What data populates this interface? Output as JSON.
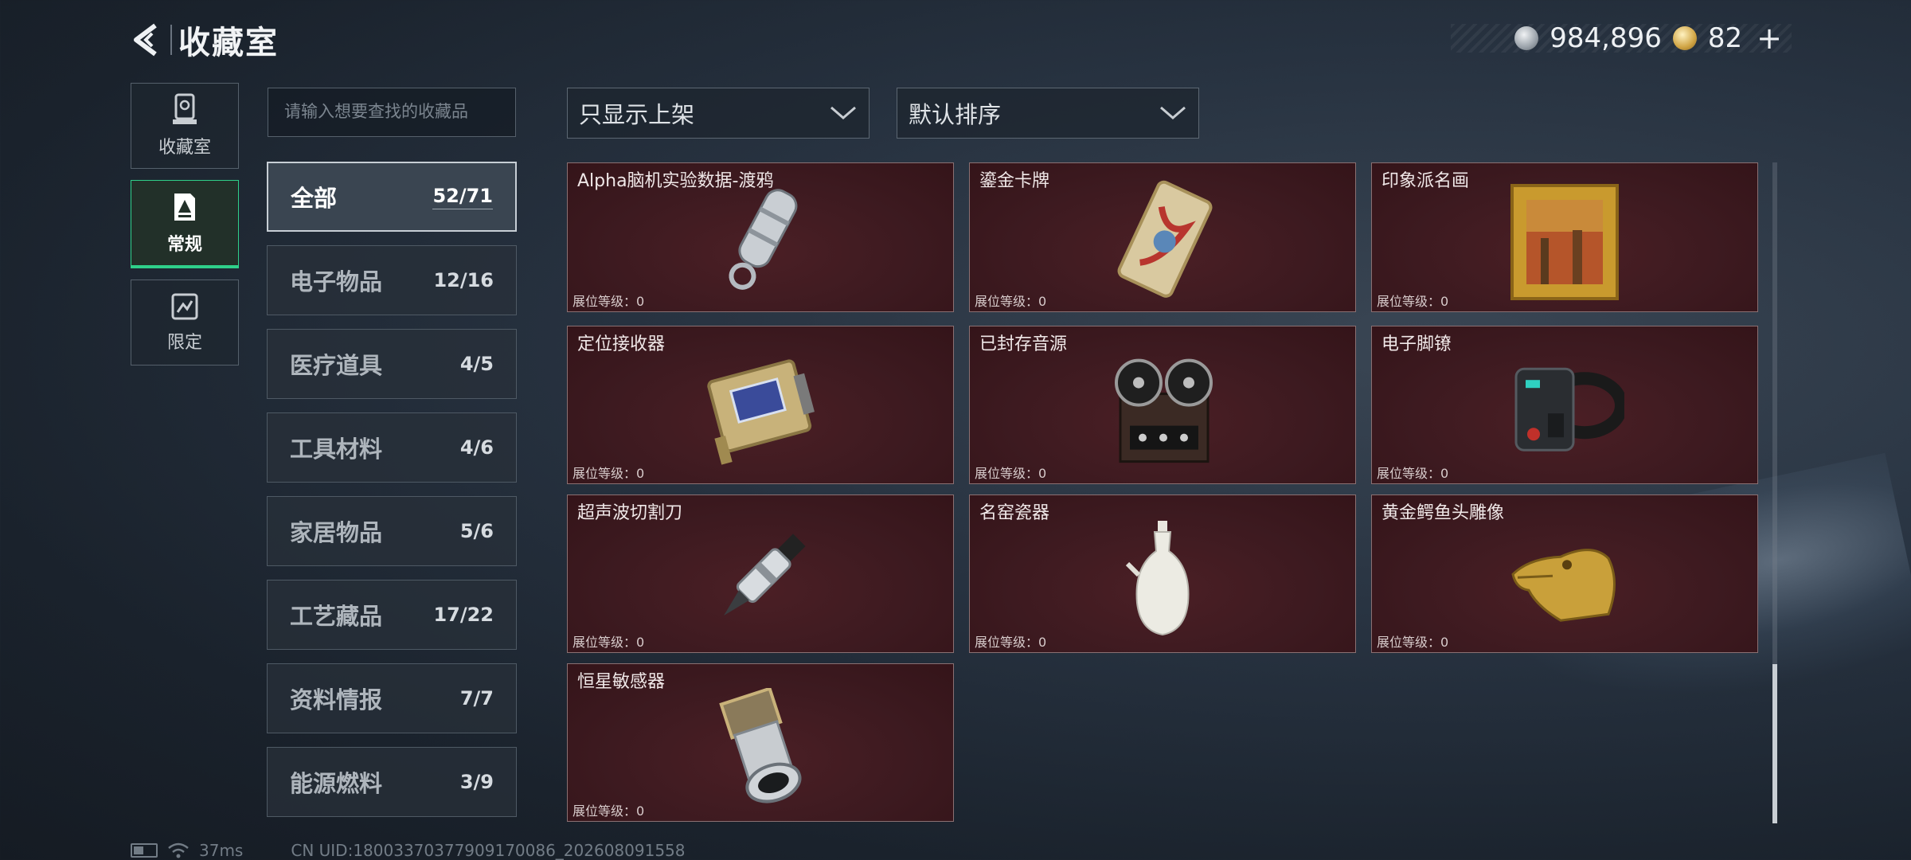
{
  "header": {
    "title": "收藏室"
  },
  "currency": {
    "silver": "984,896",
    "gold": "82"
  },
  "rail": [
    {
      "label": "收藏室",
      "icon": "display-case-icon"
    },
    {
      "label": "常规",
      "icon": "collection-card-icon"
    },
    {
      "label": "限定",
      "icon": "limited-card-icon"
    }
  ],
  "search": {
    "placeholder": "请输入想要查找的收藏品"
  },
  "categories": [
    {
      "name": "全部",
      "count": "52/71"
    },
    {
      "name": "电子物品",
      "count": "12/16"
    },
    {
      "name": "医疗道具",
      "count": "4/5"
    },
    {
      "name": "工具材料",
      "count": "4/6"
    },
    {
      "name": "家居物品",
      "count": "5/6"
    },
    {
      "name": "工艺藏品",
      "count": "17/22"
    },
    {
      "name": "资料情报",
      "count": "7/7"
    },
    {
      "name": "能源燃料",
      "count": "3/9"
    }
  ],
  "filters": {
    "display": "只显示上架",
    "sort": "默认排序"
  },
  "items": [
    {
      "title": "Alpha脑机实验数据-渡鸦",
      "level": "展位等级：0",
      "icon": "data-capsule-icon"
    },
    {
      "title": "鎏金卡牌",
      "level": "展位等级：0",
      "icon": "gilded-card-icon"
    },
    {
      "title": "印象派名画",
      "level": "展位等级：0",
      "icon": "framed-painting-icon"
    },
    {
      "title": "定位接收器",
      "level": "展位等级：0",
      "icon": "gps-receiver-icon"
    },
    {
      "title": "已封存音源",
      "level": "展位等级：0",
      "icon": "reel-to-reel-tape-icon"
    },
    {
      "title": "电子脚镣",
      "level": "展位等级：0",
      "icon": "ankle-monitor-icon"
    },
    {
      "title": "超声波切割刀",
      "level": "展位等级：0",
      "icon": "ultrasonic-cutter-icon"
    },
    {
      "title": "名窑瓷器",
      "level": "展位等级：0",
      "icon": "porcelain-vase-icon"
    },
    {
      "title": "黄金鳄鱼头雕像",
      "level": "展位等级：0",
      "icon": "gold-crocodile-head-icon"
    },
    {
      "title": "恒星敏感器",
      "level": "展位等级：0",
      "icon": "star-sensor-icon"
    }
  ],
  "status": {
    "ping": "37ms",
    "uid": "CN UID:18003370377909170086_202608091558"
  },
  "colors": {
    "accent": "#2fd08a",
    "card_bg": "#3d1a20"
  }
}
